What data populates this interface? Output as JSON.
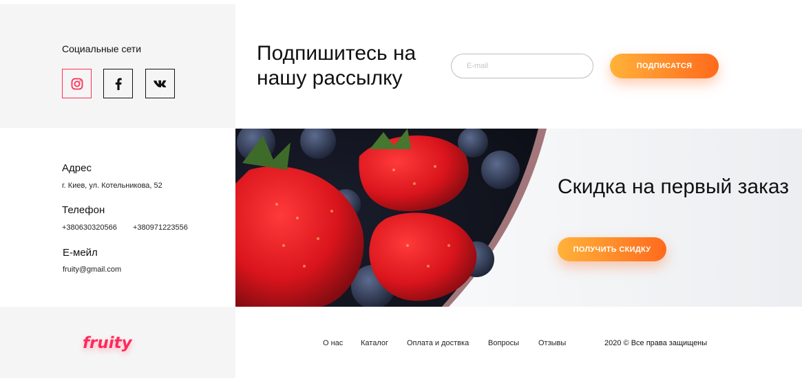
{
  "social": {
    "title": "Социальные сети",
    "icons": [
      "instagram-icon",
      "facebook-icon",
      "vk-icon"
    ],
    "instagram_color": "#ff2d55"
  },
  "subscribe": {
    "title": "Подпишитесь на нашу рассылку",
    "email_placeholder": "E-mail",
    "button_label": "ПОДПИСАТСЯ"
  },
  "contacts": {
    "address_label": "Адрес",
    "address_value": "г. Киев, ул. Котельникова, 52",
    "phone_label": "Телефон",
    "phone_1": "+380630320566",
    "phone_2": "+380971223556",
    "email_label": "Е-мейл",
    "email_value": "fruity@gmail.com"
  },
  "promo": {
    "title": "Скидка на первый заказ",
    "button_label": "ПОЛУЧИТЬ СКИДКУ"
  },
  "footer": {
    "logo": "fruity",
    "logo_color": "#ff2a5a",
    "nav": [
      "О нас",
      "Каталог",
      "Оплата и доствка",
      "Вопросы",
      "Отзывы"
    ],
    "copyright": "2020 © Все права защищены"
  },
  "colors": {
    "accent_start": "#ffb23a",
    "accent_end": "#ff6a1c",
    "panel_gray": "#f5f5f5"
  }
}
